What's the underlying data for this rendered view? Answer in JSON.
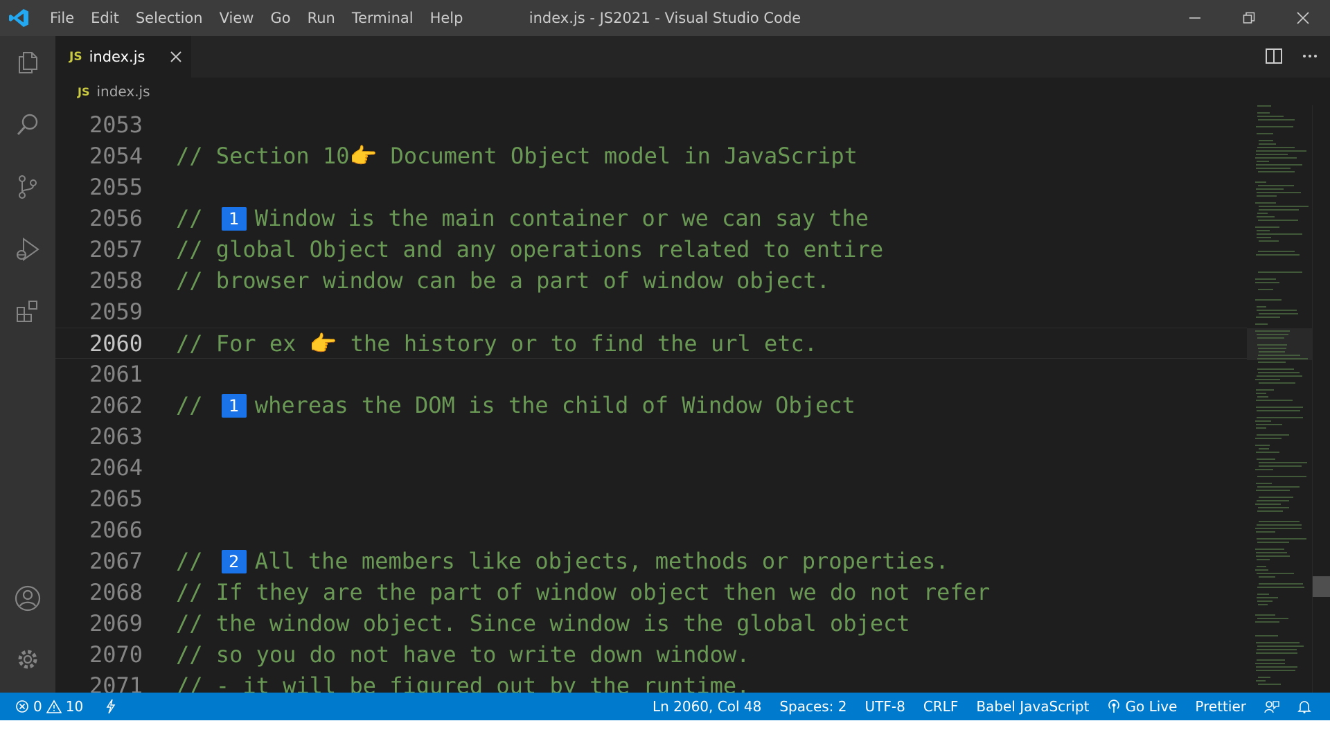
{
  "window": {
    "title": "index.js - JS2021 - Visual Studio Code",
    "menu": [
      "File",
      "Edit",
      "Selection",
      "View",
      "Go",
      "Run",
      "Terminal",
      "Help"
    ]
  },
  "tab": {
    "badge": "JS",
    "label": "index.js"
  },
  "breadcrumb": {
    "badge": "JS",
    "file": "index.js"
  },
  "editor": {
    "lines": [
      {
        "num": "2053",
        "parts": []
      },
      {
        "num": "2054",
        "parts": [
          {
            "text": "// Section 10"
          },
          {
            "hand": "👉"
          },
          {
            "text": " Document Object model in JavaScript"
          }
        ]
      },
      {
        "num": "2055",
        "parts": []
      },
      {
        "num": "2056",
        "parts": [
          {
            "text": "// "
          },
          {
            "kbd": "1"
          },
          {
            "text": "Window is the main container or we can say the"
          }
        ]
      },
      {
        "num": "2057",
        "parts": [
          {
            "text": "// global Object and any operations related to entire"
          }
        ]
      },
      {
        "num": "2058",
        "parts": [
          {
            "text": "// browser window can be a part of window object."
          }
        ]
      },
      {
        "num": "2059",
        "parts": []
      },
      {
        "num": "2060",
        "current": true,
        "parts": [
          {
            "text": "// For ex "
          },
          {
            "hand": "👉"
          },
          {
            "text": " the history or to find the url etc."
          }
        ]
      },
      {
        "num": "2061",
        "parts": []
      },
      {
        "num": "2062",
        "parts": [
          {
            "text": "// "
          },
          {
            "kbd": "1"
          },
          {
            "text": "whereas the DOM is the child of Window Object"
          }
        ]
      },
      {
        "num": "2063",
        "parts": []
      },
      {
        "num": "2064",
        "parts": []
      },
      {
        "num": "2065",
        "parts": []
      },
      {
        "num": "2066",
        "parts": []
      },
      {
        "num": "2067",
        "parts": [
          {
            "text": "// "
          },
          {
            "kbd": "2"
          },
          {
            "text": "All the members like objects, methods or properties."
          }
        ]
      },
      {
        "num": "2068",
        "parts": [
          {
            "text": "// If they are the part of window object then we do not refer"
          }
        ]
      },
      {
        "num": "2069",
        "parts": [
          {
            "text": "// the window object. Since window is the global object"
          }
        ]
      },
      {
        "num": "2070",
        "parts": [
          {
            "text": "// so you do not have to write down window."
          }
        ]
      },
      {
        "num": "2071",
        "parts": [
          {
            "text": "// - it will be figured out by the runtime."
          }
        ]
      }
    ]
  },
  "status": {
    "errors": "0",
    "warnings": "10",
    "position": "Ln 2060, Col 48",
    "spaces": "Spaces: 2",
    "encoding": "UTF-8",
    "eol": "CRLF",
    "language": "Babel JavaScript",
    "golive": "Go Live",
    "prettier": "Prettier"
  },
  "colors": {
    "comment": "#6a9955",
    "statusbar": "#007acc",
    "badge_blue": "#1a73e8",
    "js_yellow": "#cbcb41"
  },
  "icons": {
    "activity": [
      "explorer-icon",
      "search-icon",
      "source-control-icon",
      "run-debug-icon",
      "extensions-icon",
      "accounts-icon",
      "settings-gear-icon"
    ],
    "editor_actions": [
      "split-editor-icon",
      "more-actions-icon"
    ]
  }
}
